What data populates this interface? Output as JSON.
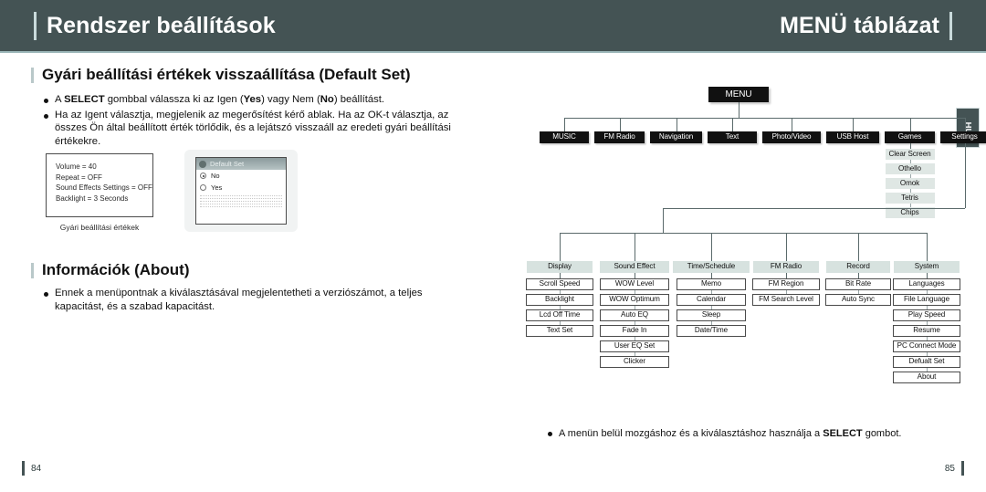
{
  "header": {
    "left_title": "Rendszer beállítások",
    "right_title": "MENÜ táblázat"
  },
  "side_tab": {
    "label": "HU"
  },
  "footer": {
    "page_left": "84",
    "page_right": "85"
  },
  "left_page": {
    "section1": {
      "title": "Gyári beállítási értékek visszaállítása (Default Set)",
      "bullets": [
        {
          "parts": [
            {
              "text": "A "
            },
            {
              "text": "SELECT",
              "bold": true
            },
            {
              "text": " gombbal válassza ki az Igen ("
            },
            {
              "text": "Yes",
              "bold": true
            },
            {
              "text": ") vagy Nem ("
            },
            {
              "text": "No",
              "bold": true
            },
            {
              "text": ") beállítást."
            }
          ]
        },
        {
          "parts": [
            {
              "text": "Ha az Igent választja, megjelenik az megerősítést kérő ablak. Ha az OK-t választja, az összes Ön által beállított érték törlődik, és a lejátszó visszaáll az eredeti gyári beállítási értékekre."
            }
          ]
        }
      ],
      "lcd_shot": {
        "lines": [
          "Volume = 40",
          "Repeat = OFF",
          "Sound Effects Settings = OFF",
          "Backlight = 3 Seconds"
        ],
        "caption": "Gyári beállítási értékek"
      },
      "dialog_shot": {
        "title": "Default Set",
        "options": [
          {
            "label": "No",
            "selected": true
          },
          {
            "label": "Yes",
            "selected": false
          }
        ]
      }
    },
    "section2": {
      "title": "Információk (About)",
      "bullets": [
        {
          "parts": [
            {
              "text": "Ennek a menüpontnak a kiválasztásával megjelentetheti a verziószámot, a teljes kapacitást, és a szabad kapacitást."
            }
          ]
        }
      ]
    }
  },
  "right_page": {
    "root": {
      "label": "MENU"
    },
    "level1": [
      {
        "label": "MUSIC"
      },
      {
        "label": "FM Radio"
      },
      {
        "label": "Navigation"
      },
      {
        "label": "Text"
      },
      {
        "label": "Photo/Video"
      },
      {
        "label": "USB Host"
      },
      {
        "label": "Games"
      },
      {
        "label": "Settings"
      }
    ],
    "games_children": [
      "Clear Screen",
      "Othello",
      "Omok",
      "Tetris",
      "Chips"
    ],
    "settings_groups": [
      {
        "label": "Display",
        "items": [
          "Scroll Speed",
          "Backlight",
          "Lcd Off Time",
          "Text Set"
        ]
      },
      {
        "label": "Sound Effect",
        "items": [
          "WOW Level",
          "WOW Optimum",
          "Auto EQ",
          "Fade In",
          "User EQ Set",
          "Clicker"
        ]
      },
      {
        "label": "Time/Schedule",
        "items": [
          "Memo",
          "Calendar",
          "Sleep",
          "Date/Time"
        ]
      },
      {
        "label": "FM Radio",
        "items": [
          "FM Region",
          "FM Search Level"
        ]
      },
      {
        "label": "Record",
        "items": [
          "Bit Rate",
          "Auto Sync"
        ]
      },
      {
        "label": "System",
        "items": [
          "Languages",
          "File Language",
          "Play Speed",
          "Resume",
          "PC Connect Mode",
          "Defualt Set",
          "About"
        ]
      }
    ],
    "note": {
      "parts": [
        {
          "text": "A menün belül mozgáshoz és a kiválasztáshoz használja a "
        },
        {
          "text": "SELECT",
          "bold": true
        },
        {
          "text": " gombot."
        }
      ]
    }
  }
}
